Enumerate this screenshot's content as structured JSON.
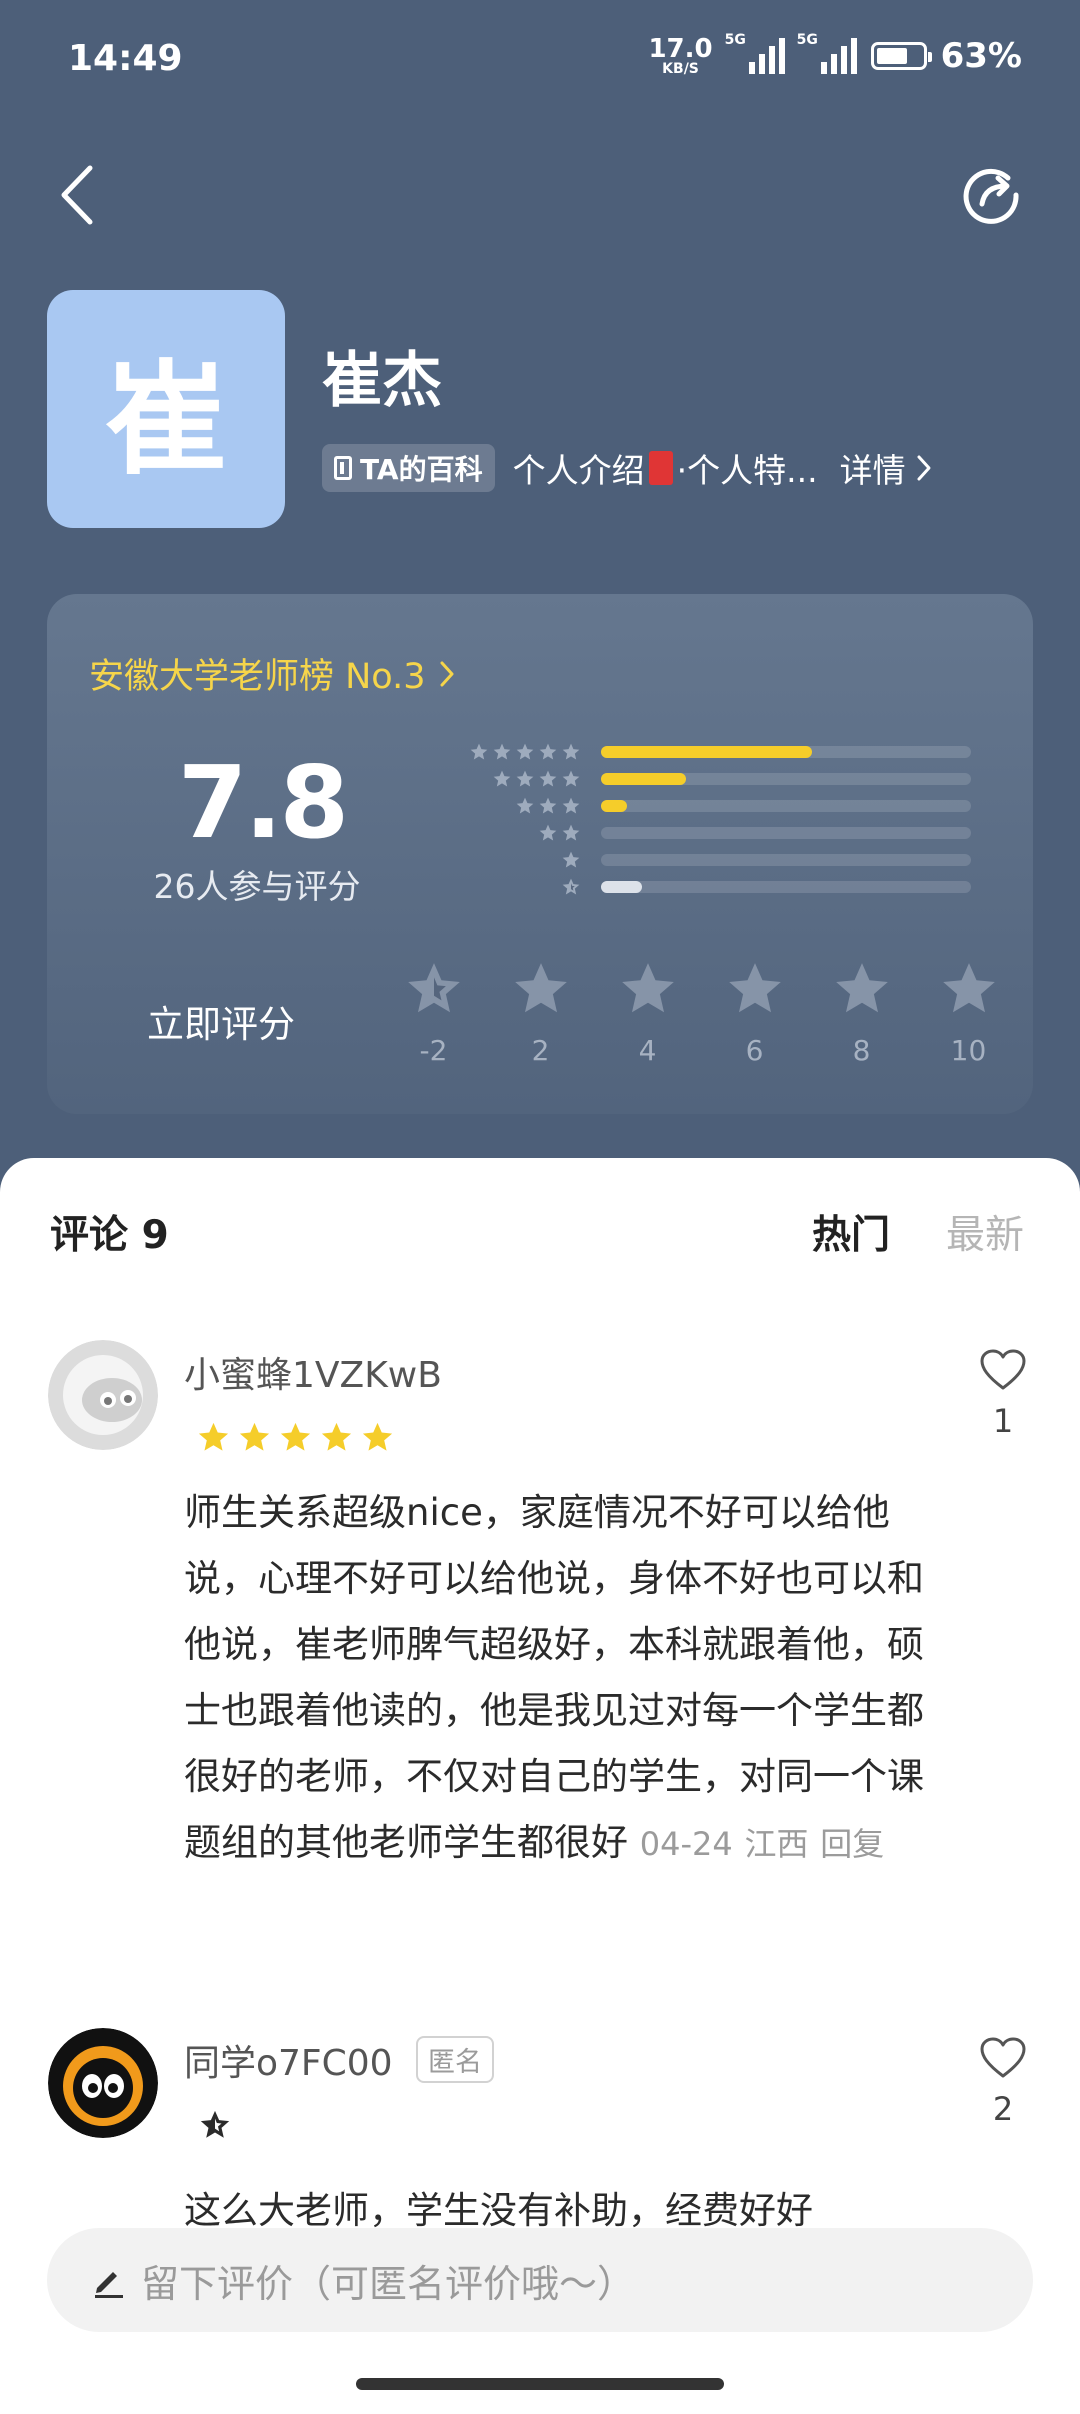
{
  "status_bar": {
    "time": "14:49",
    "net_speed": "17.0",
    "net_unit": "KB/S",
    "sig1": "5G",
    "sig2": "5G",
    "battery": "63%"
  },
  "teacher": {
    "avatar_char": "崔",
    "name": "崔杰",
    "wiki_badge": "TA的百科",
    "intro_pre": "个人介绍",
    "intro_post": "·个人特...",
    "detail": "详情"
  },
  "rating": {
    "rank": "安徽大学老师榜 No.3",
    "score": "7.8",
    "count": "26人参与评分",
    "rate_now": "立即评分",
    "distribution": [
      {
        "stars": 5,
        "fraction": 0.57,
        "color": "#f5cd2a"
      },
      {
        "stars": 4,
        "fraction": 0.23,
        "color": "#f5cd2a"
      },
      {
        "stars": 3,
        "fraction": 0.07,
        "color": "#f5cd2a"
      },
      {
        "stars": 2,
        "fraction": 0,
        "color": "#f5cd2a"
      },
      {
        "stars": 1,
        "fraction": 0,
        "color": "#f5cd2a"
      },
      {
        "stars": 0,
        "fraction": 0.11,
        "color": "#dde2ea"
      }
    ],
    "scale": [
      "-2",
      "2",
      "4",
      "6",
      "8",
      "10"
    ]
  },
  "comments_section": {
    "title": "评论 9",
    "tab_hot": "热门",
    "tab_new": "最新",
    "items": [
      {
        "user": "小蜜蜂1VZKwB",
        "stars": 5,
        "text": "师生关系超级nice，家庭情况不好可以给他说，心理不好可以给他说，身体不好也可以和他说，崔老师脾气超级好，本科就跟着他，硕士也跟着他读的，他是我见过对每一个学生都很好的老师，不仅对自己的学生，对同一个课题组的其他老师学生都很好",
        "date": "04-24",
        "location": "江西",
        "reply": "回复",
        "likes": "1"
      },
      {
        "user": "同学o7FC00",
        "badge": "匿名",
        "text": "这么大老师，学生没有补助，经费好好",
        "likes": "2"
      }
    ]
  },
  "input": {
    "placeholder": "留下评价（可匿名评价哦～）"
  },
  "colors": {
    "header_bg": "#4d5f79",
    "accent_yellow": "#f5cd2a",
    "rank_yellow": "#f6d54a"
  }
}
